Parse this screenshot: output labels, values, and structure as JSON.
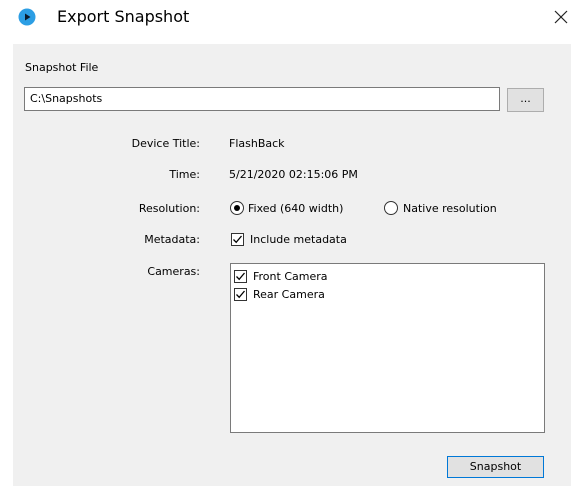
{
  "window": {
    "title": "Export Snapshot",
    "close_glyph": "✕"
  },
  "snapshot_file": {
    "label": "Snapshot File",
    "path": "C:\\Snapshots",
    "browse_label": "..."
  },
  "fields": {
    "device_title_label": "Device Title:",
    "device_title_value": "FlashBack",
    "time_label": "Time:",
    "time_value": "5/21/2020 02:15:06 PM",
    "resolution_label": "Resolution:",
    "resolution_options": [
      {
        "label": "Fixed (640 width)",
        "selected": true
      },
      {
        "label": "Native resolution",
        "selected": false
      }
    ],
    "metadata_label": "Metadata:",
    "metadata_checkbox": {
      "label": "Include metadata",
      "checked": true
    },
    "cameras_label": "Cameras:",
    "cameras": [
      {
        "label": "Front Camera",
        "checked": true
      },
      {
        "label": "Rear Camera",
        "checked": true
      }
    ]
  },
  "actions": {
    "snapshot_label": "Snapshot"
  },
  "colors": {
    "accent": "#2c9ee4",
    "default_button_border": "#0078d7",
    "panel_bg": "#f0f0f0"
  },
  "icons": {
    "app": "play-circle-icon",
    "close": "close-icon"
  }
}
